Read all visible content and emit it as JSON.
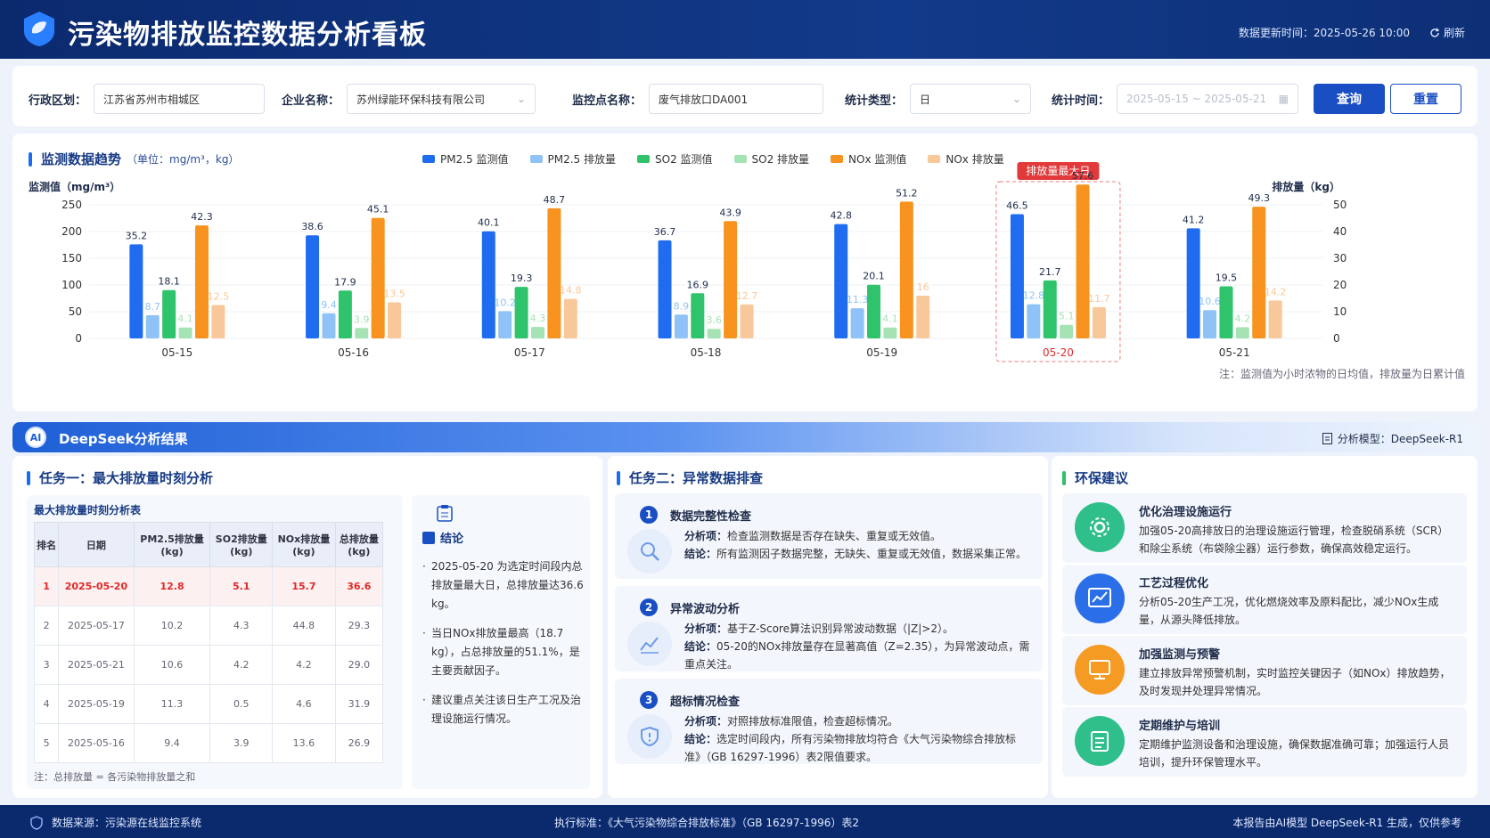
{
  "header": {
    "title": "污染物排放监控数据分析看板",
    "update_label": "数据更新时间：",
    "update_time": "2025-05-26 10:00",
    "refresh_label": "刷新"
  },
  "filters": {
    "region_label": "行政区划：",
    "region_value": "江苏省苏州市相城区",
    "company_label": "企业名称：",
    "company_value": "苏州绿能环保科技有限公司",
    "point_label": "监控点名称：",
    "point_value": "废气排放口DA001",
    "stat_type_label": "统计类型：",
    "stat_type_value": "日",
    "time_label": "统计时间：",
    "time_value": "2025-05-15 ~ 2025-05-21",
    "query_label": "查询",
    "reset_label": "重置"
  },
  "chart_section": {
    "title": "监测数据趋势",
    "unit": "（单位：mg/m³，kg）",
    "badge": "排放量最大日",
    "note": "注：监测值为小时浓物的日均值，排放量为日累计值"
  },
  "chart_data": {
    "type": "bar",
    "categories": [
      "05-15",
      "05-16",
      "05-17",
      "05-18",
      "05-19",
      "05-20",
      "05-21"
    ],
    "highlight_category": "05-20",
    "ylabel": "监测值（mg/m³）",
    "ylabel_right": "排放量（kg）",
    "ylim": [
      0,
      250
    ],
    "ylim_right": [
      0,
      50
    ],
    "yticks": [
      0,
      50,
      100,
      150,
      200,
      250
    ],
    "yticks_right": [
      0,
      10,
      20,
      30,
      40,
      50
    ],
    "grid": true,
    "series": [
      {
        "name": "PM2.5 监测值",
        "axis": "right",
        "color": "#1f6cf0",
        "values": [
          35.2,
          38.6,
          40.1,
          36.7,
          42.8,
          46.5,
          41.2
        ]
      },
      {
        "name": "PM2.5 排放量",
        "axis": "right",
        "color": "#8fc3f7",
        "values": [
          8.7,
          9.4,
          10.2,
          8.9,
          11.3,
          12.8,
          10.6
        ]
      },
      {
        "name": "SO2 监测值",
        "axis": "right",
        "color": "#2fc36b",
        "values": [
          18.1,
          17.9,
          19.3,
          16.9,
          20.1,
          21.7,
          19.5
        ]
      },
      {
        "name": "SO2 排放量",
        "axis": "right",
        "color": "#a6e3b4",
        "values": [
          4.1,
          3.9,
          4.3,
          3.6,
          4.1,
          5.1,
          4.2
        ]
      },
      {
        "name": "NOx 监测值",
        "axis": "right",
        "color": "#f7931e",
        "values": [
          42.3,
          45.1,
          48.7,
          43.9,
          51.2,
          57.6,
          49.3
        ]
      },
      {
        "name": "NOx 排放量",
        "axis": "right",
        "color": "#f9c89a",
        "values": [
          12.5,
          13.5,
          14.8,
          12.7,
          16.0,
          11.7,
          14.2
        ]
      }
    ]
  },
  "banner": {
    "icon_text": "AI",
    "title": "DeepSeek分析结果",
    "model_label": "分析模型：DeepSeek-R1"
  },
  "task1": {
    "title": "任务一：最大排放量时刻分析",
    "table_title": "最大排放量时刻分析表",
    "headers": [
      "排名",
      "日期",
      "PM2.5排放量\n(kg)",
      "SO2排放量\n(kg)",
      "NOx排放量\n(kg)",
      "总排放量\n(kg)"
    ],
    "rows": [
      [
        "1",
        "2025-05-20",
        "12.8",
        "5.1",
        "15.7",
        "36.6"
      ],
      [
        "2",
        "2025-05-17",
        "10.2",
        "4.3",
        "44.8",
        "29.3"
      ],
      [
        "3",
        "2025-05-21",
        "10.6",
        "4.2",
        "4.2",
        "29.0"
      ],
      [
        "4",
        "2025-05-19",
        "11.3",
        "0.5",
        "4.6",
        "31.9"
      ],
      [
        "5",
        "2025-05-16",
        "9.4",
        "3.9",
        "13.6",
        "26.9"
      ]
    ],
    "table_note": "注：总排放量 = 各污染物排放量之和",
    "conclusion_title": "结论",
    "conclusions": [
      "2025-05-20 为选定时间段内总排放量最大日，总排放量达36.6 kg。",
      "当日NOx排放量最高（18.7 kg），占总排放量的51.1%，是主要贡献因子。",
      "建议重点关注该日生产工况及治理设施运行情况。"
    ]
  },
  "task2": {
    "title": "任务二：异常数据排查",
    "items": [
      {
        "num": "1",
        "title": "数据完整性检查",
        "a_label": "分析项：",
        "a_text": "检查监测数据是否存在缺失、重复或无效值。",
        "c_label": "结论：",
        "c_text": "所有监测因子数据完整，无缺失、重复或无效值，数据采集正常。"
      },
      {
        "num": "2",
        "title": "异常波动分析",
        "a_label": "分析项：",
        "a_text": "基于Z-Score算法识别异常波动数据（|Z|>2）。",
        "c_label": "结论：",
        "c_text": "05-20的NOx排放量存在显著高值（Z=2.35），为异常波动点，需重点关注。"
      },
      {
        "num": "3",
        "title": "超标情况检查",
        "a_label": "分析项：",
        "a_text": "对照排放标准限值，检查超标情况。",
        "c_label": "结论：",
        "c_text": "选定时间段内，所有污染物排放均符合《大气污染物综合排放标准》（GB 16297-1996）表2限值要求。"
      }
    ]
  },
  "suggestions": {
    "title": "环保建议",
    "items": [
      {
        "title": "优化治理设施运行",
        "text": "加强05-20高排放日的治理设施运行管理，检查脱硝系统（SCR）和除尘系统（布袋除尘器）运行参数，确保高效稳定运行。",
        "icon": "gear-icon",
        "color": "#2fbf8a"
      },
      {
        "title": "工艺过程优化",
        "text": "分析05-20生产工况，优化燃烧效率及原料配比，减少NOx生成量，从源头降低排放。",
        "icon": "chart-icon",
        "color": "#2a6ee8"
      },
      {
        "title": "加强监测与预警",
        "text": "建立排放异常预警机制，实时监控关键因子（如NOx）排放趋势，及时发现并处理异常情况。",
        "icon": "monitor-icon",
        "color": "#f59a23"
      },
      {
        "title": "定期维护与培训",
        "text": "定期维护监测设备和治理设施，确保数据准确可靠；加强运行人员培训，提升环保管理水平。",
        "icon": "clipboard-icon",
        "color": "#2fbf8a"
      }
    ]
  },
  "footer": {
    "source": "数据来源：污染源在线监控系统",
    "standard": "执行标准：《大气污染物综合排放标准》（GB 16297-1996）表2",
    "generated": "本报告由AI模型 DeepSeek-R1 生成，仅供参考"
  }
}
